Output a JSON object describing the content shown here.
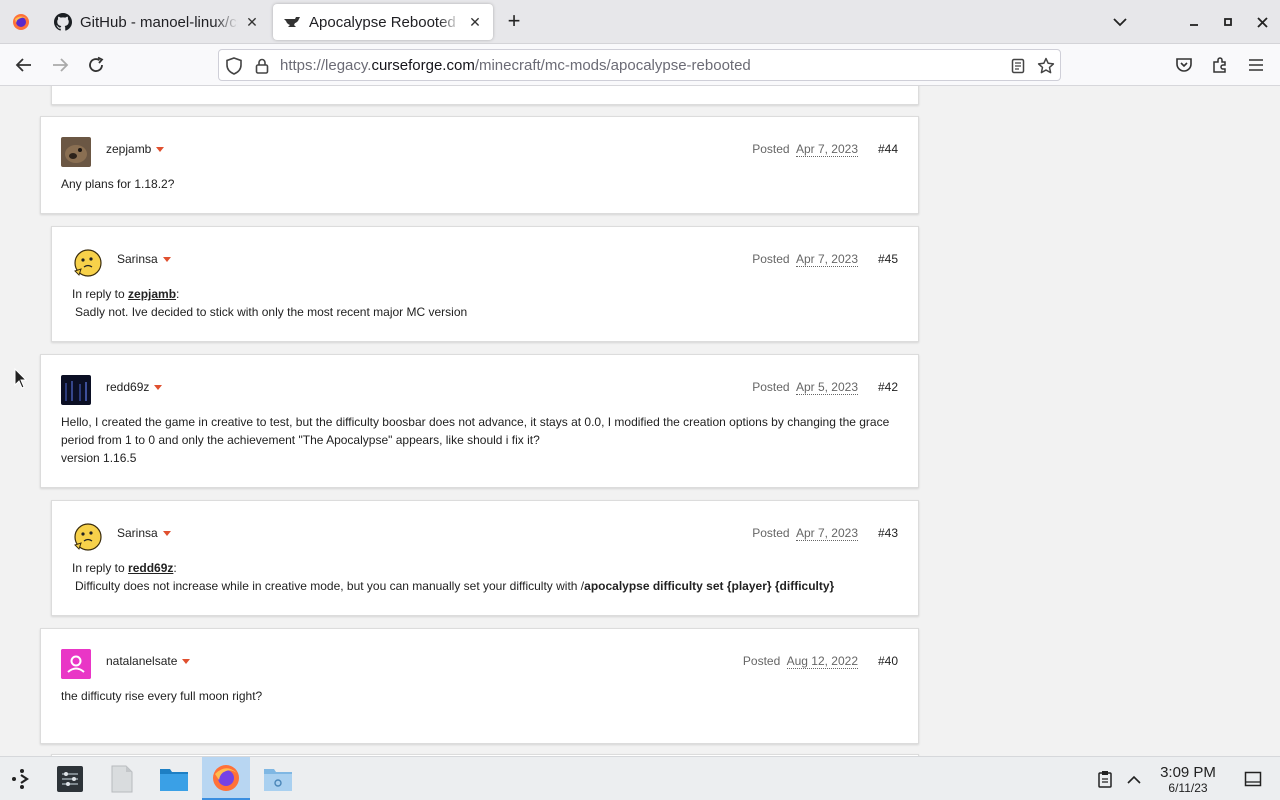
{
  "tabs": [
    {
      "title": "GitHub - manoel-linux/cp",
      "active": false
    },
    {
      "title": "Apocalypse Rebooted - M",
      "active": true
    }
  ],
  "address_bar": {
    "prefix": "https://legacy.",
    "domain": "curseforge.com",
    "path": "/minecraft/mc-mods/apocalypse-rebooted"
  },
  "comments": [
    {
      "username": "zepjamb",
      "posted_label": "Posted",
      "date": "Apr 7, 2023",
      "number": "#44",
      "lines": [
        "Any plans for 1.18.2?"
      ]
    },
    {
      "username": "Sarinsa",
      "posted_label": "Posted",
      "date": "Apr 7, 2023",
      "number": "#45",
      "reply_prefix": "In reply to ",
      "reply_to": "zepjamb",
      "lines": [
        "Sadly not. Ive decided to stick with only the most recent major MC version"
      ]
    },
    {
      "username": "redd69z",
      "posted_label": "Posted",
      "date": "Apr 5, 2023",
      "number": "#42",
      "lines": [
        "Hello, I created the game in creative to test, but the difficulty boosbar does not advance, it stays at 0.0, I modified the creation options by changing the grace",
        "period from 1 to 0 and only the achievement \"The Apocalypse\" appears, like should i fix it?",
        "version 1.16.5"
      ]
    },
    {
      "username": "Sarinsa",
      "posted_label": "Posted",
      "date": "Apr 7, 2023",
      "number": "#43",
      "reply_prefix": "In reply to ",
      "reply_to": "redd69z",
      "line_plain": "Difficulty does not increase while in creative mode, but you can manually set your difficulty with /",
      "line_bold": "apocalypse difficulty set {player} {difficulty}"
    },
    {
      "username": "natalanelsate",
      "posted_label": "Posted",
      "date": "Aug 12, 2022",
      "number": "#40",
      "lines": [
        "the difficuty rise every full moon right?"
      ]
    }
  ],
  "taskbar": {
    "time": "3:09 PM",
    "date": "6/11/23"
  },
  "colors": {
    "accent_caret": "#e0502f",
    "firefox_active_bg": "#b8d6f2"
  }
}
